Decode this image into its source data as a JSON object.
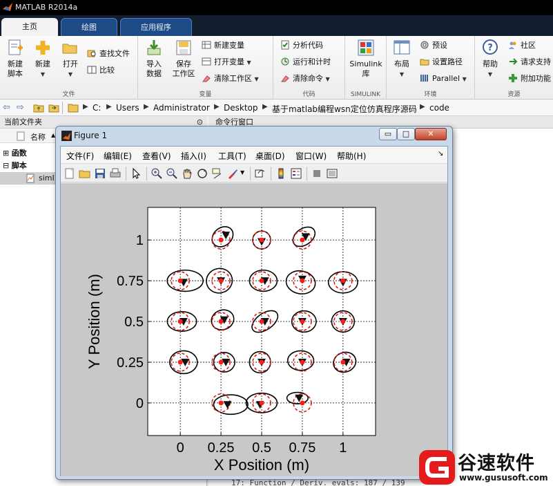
{
  "window": {
    "title": "MATLAB R2014a"
  },
  "tabs": [
    {
      "label": "主页"
    },
    {
      "label": "绘图"
    },
    {
      "label": "应用程序"
    }
  ],
  "ribbon": {
    "file": {
      "new_script": "新建\n脚本",
      "new_script_l1": "新建",
      "new_script_l2": "脚本",
      "new": "新建",
      "open": "打开",
      "find_files": "查找文件",
      "compare": "比较",
      "group": "文件"
    },
    "variable": {
      "import_l1": "导入",
      "import_l2": "数据",
      "save_l1": "保存",
      "save_l2": "工作区",
      "new_var": "新建变量",
      "open_var": "打开变量",
      "clear_ws": "清除工作区",
      "group": "变量"
    },
    "code": {
      "analyze": "分析代码",
      "run_time": "运行和计时",
      "clear_cmd": "清除命令",
      "group": "代码"
    },
    "simulink": {
      "l1": "Simulink",
      "l2": "库",
      "group": "SIMULINK"
    },
    "env": {
      "layout": "布局",
      "prefs": "预设",
      "set_path": "设置路径",
      "parallel": "Parallel",
      "group": "环境"
    },
    "resources": {
      "help": "帮助",
      "community": "社区",
      "request_support": "请求支持",
      "addons": "附加功能",
      "group": "资源"
    }
  },
  "address": {
    "crumbs": [
      "C:",
      "Users",
      "Administrator",
      "Desktop",
      "基于matlab编程wsn定位仿真程序源码",
      "code"
    ]
  },
  "left_panel": {
    "header": "当前文件夹",
    "column": "名称",
    "sort_arrow": "▲",
    "items": [
      {
        "expander": "⊞",
        "label": "函数"
      },
      {
        "expander": "⊟",
        "label": "脚本"
      },
      {
        "label": "simI"
      }
    ]
  },
  "command_window": {
    "header": "命令行窗口",
    "last_line": "17: Function / Deriv. evals: 187 / 139"
  },
  "figure": {
    "title": "Figure 1",
    "menu": [
      "文件(F)",
      "编辑(E)",
      "查看(V)",
      "插入(I)",
      "工具(T)",
      "桌面(D)",
      "窗口(W)",
      "帮助(H)"
    ],
    "menu_overflow": "↘",
    "buttons": {
      "minimize": "▭",
      "maximize": "□",
      "close": "✕"
    }
  },
  "chart_data": {
    "type": "scatter",
    "xlabel": "X Position (m)",
    "ylabel": "Y Position (m)",
    "xlim": [
      -0.2,
      1.2
    ],
    "ylim": [
      -0.2,
      1.2
    ],
    "xticks": [
      0,
      0.25,
      0.5,
      0.75,
      1
    ],
    "yticks": [
      0,
      0.25,
      0.5,
      0.75,
      1
    ],
    "xtick_labels": [
      "0",
      "0.25",
      "0.5",
      "0.75",
      "1"
    ],
    "ytick_labels": [
      "0",
      "0.25",
      "0.5",
      "0.75",
      "1"
    ],
    "grid": true,
    "grid_style": "dashed",
    "colors": {
      "true_node": "#ff1a1a",
      "estimate": "#111111",
      "true_ellipse": "#e01818",
      "estimate_ellipse": "#000000",
      "axes_bg": "#ffffff",
      "figure_bg": "#c8c8c8"
    },
    "series": [
      {
        "name": "",
        "marker": "red-dot",
        "points": [
          [
            0.25,
            1
          ],
          [
            0.5,
            1
          ],
          [
            0.75,
            1
          ],
          [
            0,
            0.75
          ],
          [
            0.25,
            0.75
          ],
          [
            0.5,
            0.75
          ],
          [
            0.75,
            0.75
          ],
          [
            1,
            0.75
          ],
          [
            0,
            0.5
          ],
          [
            0.25,
            0.5
          ],
          [
            0.5,
            0.5
          ],
          [
            0.75,
            0.5
          ],
          [
            1,
            0.5
          ],
          [
            0,
            0.25
          ],
          [
            0.25,
            0.25
          ],
          [
            0.5,
            0.25
          ],
          [
            0.75,
            0.25
          ],
          [
            1,
            0.25
          ],
          [
            0.25,
            0
          ],
          [
            0.5,
            0
          ],
          [
            0.75,
            0
          ]
        ]
      },
      {
        "name": "",
        "marker": "black-triangle",
        "points": [
          [
            0.28,
            1.03
          ],
          [
            0.5,
            0.99
          ],
          [
            0.77,
            1.02
          ],
          [
            0.02,
            0.74
          ],
          [
            0.25,
            0.75
          ],
          [
            0.52,
            0.75
          ],
          [
            0.75,
            0.76
          ],
          [
            1.0,
            0.74
          ],
          [
            0.02,
            0.5
          ],
          [
            0.27,
            0.51
          ],
          [
            0.52,
            0.5
          ],
          [
            0.75,
            0.5
          ],
          [
            1.0,
            0.5
          ],
          [
            0.03,
            0.25
          ],
          [
            0.28,
            0.25
          ],
          [
            0.5,
            0.25
          ],
          [
            0.75,
            0.25
          ],
          [
            1.02,
            0.25
          ],
          [
            0.29,
            -0.01
          ],
          [
            0.49,
            -0.01
          ],
          [
            0.73,
            0.03
          ]
        ]
      }
    ],
    "ellipses": [
      {
        "c": [
          0.26,
          1.02
        ],
        "r": [
          0.07,
          0.055
        ],
        "rot": -40
      },
      {
        "c": [
          0.5,
          1.0
        ],
        "r": [
          0.055,
          0.055
        ],
        "rot": 0
      },
      {
        "c": [
          0.76,
          1.02
        ],
        "r": [
          0.075,
          0.05
        ],
        "rot": -35
      },
      {
        "c": [
          0.03,
          0.75
        ],
        "r": [
          0.11,
          0.065
        ],
        "rot": 0
      },
      {
        "c": [
          0.24,
          0.75
        ],
        "r": [
          0.08,
          0.075
        ],
        "rot": -15
      },
      {
        "c": [
          0.51,
          0.75
        ],
        "r": [
          0.085,
          0.065
        ],
        "rot": 0
      },
      {
        "c": [
          0.74,
          0.74
        ],
        "r": [
          0.09,
          0.07
        ],
        "rot": 10
      },
      {
        "c": [
          1.0,
          0.74
        ],
        "r": [
          0.09,
          0.065
        ],
        "rot": 0
      },
      {
        "c": [
          0.01,
          0.5
        ],
        "r": [
          0.09,
          0.06
        ],
        "rot": 0
      },
      {
        "c": [
          0.26,
          0.51
        ],
        "r": [
          0.07,
          0.06
        ],
        "rot": -20
      },
      {
        "c": [
          0.52,
          0.5
        ],
        "r": [
          0.09,
          0.05
        ],
        "rot": -35
      },
      {
        "c": [
          0.76,
          0.5
        ],
        "r": [
          0.075,
          0.065
        ],
        "rot": 0
      },
      {
        "c": [
          1.0,
          0.5
        ],
        "r": [
          0.07,
          0.065
        ],
        "rot": 0
      },
      {
        "c": [
          0.02,
          0.25
        ],
        "r": [
          0.085,
          0.07
        ],
        "rot": 0
      },
      {
        "c": [
          0.27,
          0.25
        ],
        "r": [
          0.065,
          0.06
        ],
        "rot": 0
      },
      {
        "c": [
          0.49,
          0.25
        ],
        "r": [
          0.065,
          0.065
        ],
        "rot": 0
      },
      {
        "c": [
          0.74,
          0.26
        ],
        "r": [
          0.08,
          0.06
        ],
        "rot": 0
      },
      {
        "c": [
          1.01,
          0.25
        ],
        "r": [
          0.07,
          0.06
        ],
        "rot": -20
      },
      {
        "c": [
          0.31,
          -0.01
        ],
        "r": [
          0.105,
          0.06
        ],
        "rot": 0
      },
      {
        "c": [
          0.5,
          0.0
        ],
        "r": [
          0.095,
          0.06
        ],
        "rot": 0
      },
      {
        "c": [
          0.72,
          0.03
        ],
        "r": [
          0.065,
          0.035
        ],
        "rot": 0
      }
    ]
  }
}
